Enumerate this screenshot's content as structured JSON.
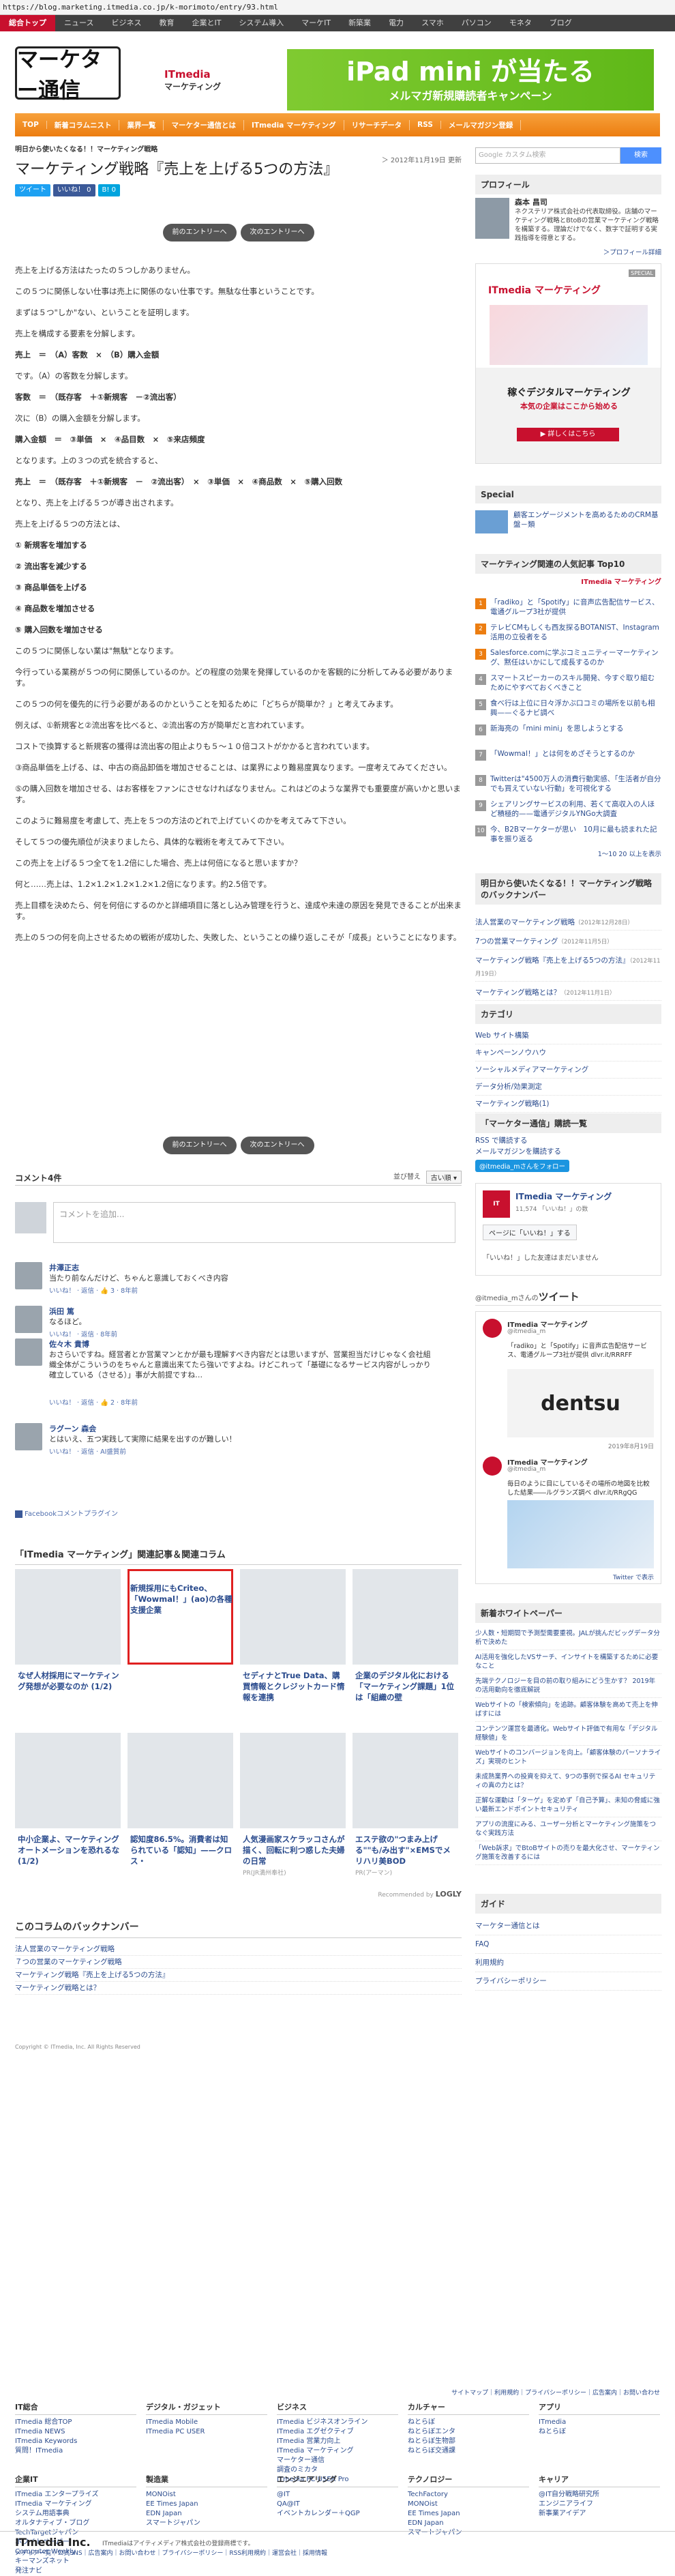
{
  "url": "https://blog.marketing.itmedia.co.jp/k-morimoto/entry/93.html",
  "gnav": [
    "総合トップ",
    "ニュース",
    "ビジネス",
    "教育",
    "企業とIT",
    "システム導入",
    "マーケIT",
    "新築業",
    "電力",
    "スマホ",
    "パソコン",
    "モネタ",
    "ブログ"
  ],
  "logo": "マーケター通信",
  "banner": {
    "brand": "ITmedia",
    "sub": "マーケティング",
    "headline": "iPad mini が当たる",
    "caption": "メルマガ新規購読者キャンペーン"
  },
  "onav": [
    "TOP",
    "新着コラムニスト",
    "業界一覧",
    "マーケター通信とは",
    "ITmedia マーケティング",
    "リサーチデータ",
    "RSS",
    "メールマガジン登録"
  ],
  "breadcrumb": "明日から使いたくなる！！マーケティング戦略",
  "date": "＞ 2012年11月19日 更新",
  "title": "マーケティング戦略『売上を上げる5つの方法』",
  "share": {
    "tweet": "ツイート",
    "like": "いいね！ 0",
    "hatena": "B! 0"
  },
  "pager": {
    "prev": "前のエントリーへ",
    "next": "次のエントリーへ"
  },
  "body": [
    "売上を上げる方法はたったの５つしかありません。",
    "この５つに関係しない仕事は売上に関係のない仕事です。無駄な仕事ということです。",
    "まずは５つ\"しか\"ない、ということを証明します。",
    "売上を構成する要素を分解します。",
    "売上　＝　（A）客数　×　（B）購入金額",
    "です。（A）の客数を分解します。",
    "客数　＝　（既存客　＋①新規客　－②流出客）",
    "次に（B）の購入金額を分解します。",
    "購入金額　＝　③単価　×　④品目数　×　⑤来店頻度",
    "となります。上の３つの式を統合すると、",
    "売上　＝　（既存客　＋①新規客　－　②流出客）　×　③単価　×　④商品数　×　⑤購入回数",
    "となり、売上を上げる５つが導き出されます。",
    "売上を上げる５つの方法とは、",
    "① 新規客を増加する",
    "② 流出客を減少する",
    "③ 商品単価を上げる",
    "④ 商品数を増加させる",
    "⑤ 購入回数を増加させる",
    "この５つに関係しない業は\"無駄\"となります。",
    "今行っている業務が５つの何に関係しているのか。どの程度の効果を発揮しているのかを客観的に分析してみる必要があります。",
    "この５つの何を優先的に行う必要があるのかということを知るために「どちらが簡単か？」と考えてみます。",
    "例えば、①新規客と②流出客を比べると、②流出客の方が簡単だと言われています。",
    "コストで換算すると新規客の獲得は流出客の阻止よりも５～１０倍コストがかかると言われています。",
    "③商品単価を上げる、は、中古の商品卸価を増加させることは、は業界により難易度異なります。一度考えてみてください。",
    "⑤の購入回数を増加させる、はお客様をファンにさせなければなりません。これはどのような業界でも重要度が高いかと思います。",
    "このように難易度を考慮して、売上を５つの方法のどれで上げていくのかを考えてみて下さい。",
    "そして５つの優先順位が決まりましたら、具体的な戦術を考えてみて下さい。",
    "この売上を上げる５つ全てを1.2倍にした場合、売上は何倍になると思いますか？",
    "何と……売上は、1.2×1.2×1.2×1.2×1.2倍になります。約2.5倍です。",
    "売上目標を決めたら、何を何倍にするのかと詳細項目に落とし込み管理を行うと、達成や未達の原因を発見できることが出来ます。",
    "売上の５つの何を向上させるための戦術が成功した、失敗した、ということの繰り返しこそが「成長」ということになります。"
  ],
  "comments": {
    "heading": "コメント4件",
    "sort_label": "並び替え",
    "sort_value": "古い順 ▾",
    "placeholder": "コメントを追加...",
    "items": [
      {
        "name": "井澤正志",
        "text": "当たり前なんだけど、ちゃんと意識しておくべき内容",
        "action": "いいね！ · 返信 · 👍 3 · 8年前"
      },
      {
        "name": "浜田 篤",
        "text": "なるほど。",
        "action": "いいね！ · 返信 · 8年前"
      },
      {
        "name": "佐々木 貴博",
        "text": "おさらいですね。経営者とか営業マンとかが最も理解すべき内容だとは思いますが、営業担当だけじゃなく会社組織全体がこういうのをちゃんと意識出来てたら強いですよね。けどこれって「基礎になるサービス内容がしっかり確立している（させる）」事が大前提ですね…",
        "action": "いいね！ · 返信 · 👍 2 · 8年前"
      },
      {
        "name": "ラグーン 森会",
        "text": "とはいえ、五つ実践して実際に結果を出すのが難しい！",
        "action": "いいね！ · 返信 · AI盛質前"
      }
    ],
    "plugin": "Facebookコメントプラグイン"
  },
  "related": {
    "heading": "「ITmedia マーケティング」関連記事＆関連コラム",
    "row1": [
      {
        "title": "なぜ人材採用にマーケティング発想が必要なのか (1/2)"
      },
      {
        "title": "新規採用にもCriteo、「Wowmal！」(ao)の各種支援企業"
      },
      {
        "title": "セディナとTrue Data、購買情報とクレジットカード情報を連携"
      },
      {
        "title": "企業のデジタル化における「マーケティング課題」1位は「組織の壁"
      }
    ],
    "row2": [
      {
        "title": "中小企業よ、マーケティングオートメーションを恐れるな (1/2)"
      },
      {
        "title": "認知度86.5%。消費者は知られている「認知」——クロス・"
      },
      {
        "title": "人気漫画家スケラッコさんが描く、回転に利つ惑した夫婦の日常",
        "sub": "PR(JR満州奉社)"
      },
      {
        "title": "エステ欲の\"つまみ上げる\"\"も/み出す\"×EMSでメリハリ美BOD",
        "sub": "PR(アーマン)"
      }
    ],
    "recommended": "Recommended by",
    "logly": "LOGLY"
  },
  "backnumber": {
    "heading": "このコラムのバックナンバー",
    "items": [
      "法人営業のマーケティング戦略",
      "７つの営業のマーケティング戦略",
      "マーケティング戦略『売上を上げる5つの方法』",
      "マーケティング戦略とは？"
    ]
  },
  "copyright": "Copyright © ITmedia, Inc. All Rights Reserved",
  "sidebar": {
    "search_placeholder": "Google カスタム検索",
    "search_button": "検索",
    "profile_heading": "プロフィール",
    "profile_name": "森本 昌司",
    "profile_text": "ネクステリア株式会社の代表取締役。店舗のマーケティング戦略とBtoBの営業マーケティング戦略を構築する。理論だけでなく、数字で証明する実践指導を得意とする。",
    "profile_link": "＞プロフィール詳細",
    "ad_brand": "ITmedia マーケティング",
    "ad_tag": "SPECIAL",
    "ad_line1": "稼ぐデジタルマーケティング",
    "ad_line2": "本気の企業はここから始める",
    "ad_more": "▶ 詳しくはこちら",
    "special_heading": "Special",
    "special_text": "顧客エンゲージメントを高めるためのCRM基盤－類",
    "ranking_heading": "マーケティング関連の人気記事 Top10",
    "ranking": [
      "「radiko」と「Spotify」に音声広告配信サービス、電通グループ3社が提供",
      "テレビCMもしくも西友探るBOTANIST、Instagram活用の立役者をる",
      "Salesforce.comに学ぶコミュニティーマーケティング、黙任はいかにして成長するのか",
      "スマートスピーカーのスキル開発、今すぐ取り組むためにやすべておくべきこと",
      "食べ行は上位に日々浮かぶ口コミの場所を以前も相興——ぐるナビ調べ",
      "新海亮の「mini mini」を思しようとする",
      "「Wowmal！」とは何をめざそうとするのか",
      "Twitterは\"4500万人の消費行動実感、「生活者が自分でも買えていない行動」を可視化する",
      "シェアリングサービスの利用、若くて高収入の人ほど積極的——電通デジタルYNGo大調査",
      "今、B2Bマーケターが思い　10月に最も読まれた記事を振り返る"
    ],
    "ranking_more": "1〜10 20 以上を表示",
    "series_heading": "明日から使いたくなる！！マーケティング戦略のバックナンバー",
    "series": [
      {
        "title": "法人営業のマーケティング戦略",
        "date": "（2012年12月28日）"
      },
      {
        "title": "7つの営業マーケティング",
        "date": "（2012年11月5日）"
      },
      {
        "title": "マーケティング戦略『売上を上げる5つの方法』",
        "date": "（2012年11月19日）"
      },
      {
        "title": "マーケティング戦略とは？",
        "date": "（2012年11月1日）"
      }
    ],
    "category_heading": "カテゴリ",
    "categories": [
      "Web サイト構築",
      "キャンペーンノウハウ",
      "ソーシャルメディアマーケティング",
      "データ分析/効果測定",
      "マーケティング戦略(1)"
    ],
    "subscribe_heading": "「マーケター通信」購読一覧",
    "subscribe": [
      "RSS で購読する",
      "メールマガジンを購読する"
    ],
    "twitter_follow": "@itmedia_mさんをフォロー",
    "fb_name": "ITmedia マーケティング",
    "fb_likes": "11,574 「いいね！」の数",
    "fb_button": "ページに「いいね！」する",
    "fb_friends": "「いいね！」した友達はまだいません",
    "tw_heading_user": "@itmedia_mさんの",
    "tw_heading": "ツイート",
    "tweet1_user": "ITmedia マーケティング",
    "tweet1_handle": "@itmedia_m",
    "tweet1_text": "「radiko」と「Spotify」に音声広告配信サービス、電通グループ3社が提供 dlvr.it/RRRFF",
    "tweet_img": "dentsu",
    "tweet_date": "2019年8月19日",
    "tweet2_user": "ITmedia マーケティング",
    "tweet2_handle": "@itmedia_m",
    "tweet2_text": "毎日のように目にしているその場所の地図を比較した結果――ルグランズ調べ dlvr.it/RRgQG",
    "tw_embed": "Twitter で表示",
    "whitepaper_heading": "新着ホワイトペーパー",
    "whitepapers": [
      "少人数・短期間で予測型需要重視。JALが挑んだビッグデータ分析で決めた",
      "AI活用を強化したVSサーチ、インサイトを構築するために必要なこと",
      "先端テクノロジーを目の前の取り組みにどう生かす？ 2019年の活用動向を徹底解説",
      "Webサイトの「検索傾向」を追跡。顧客体験を高めて売上を伸ばすには",
      "コンテンツ運営を最適化。Webサイト評価で有用な「デジタル経験値」を",
      "Webサイトのコンバージョンを向上。「顧客体験のパーソナライズ」実現のヒント",
      "未成熟業界への投資を抑えて、9つの事例で探るAI セキュリティの真の力とは？",
      "正解な運動は「ターゲ」を定めず「自己予算」、未知の脅威に強い最新エンドポイントセキュリティ",
      "アプリの流度にみる、ユーザー分析とマーケティング施策をつなぐ実践方法",
      "「Web訴求」でBtoBサイトの売りを最大化させ、マーケティング施策を改善するには"
    ],
    "guide_heading": "ガイド",
    "guide": [
      "マーケター通信とは",
      "FAQ",
      "利用規約",
      "プライバシーポリシー"
    ]
  },
  "footer": {
    "sitemap": "サイトマップ｜利用規約｜プライバシーポリシー｜広告案内｜お問い合わせ",
    "cols1": [
      {
        "title": "IT総合",
        "items": [
          "ITmedia 総合TOP",
          "ITmedia NEWS",
          "ITmedia Keywords",
          "質問！ITmedia"
        ]
      },
      {
        "title": "デジタル・ガジェット",
        "items": [
          "ITmedia Mobile",
          "ITmedia PC USER"
        ]
      },
      {
        "title": "ビジネス",
        "items": [
          "ITmedia ビジネスオンライン",
          "ITmedia エグゼクティブ",
          "ITmedia 営業力向上",
          "ITmedia マーケティング",
          "マーケター通信",
          "調査のミカタ",
          "ITmedia PC USER Pro"
        ]
      },
      {
        "title": "カルチャー",
        "items": [
          "ねとらぼ",
          "ねとらぼエンタ",
          "ねとらぼ生物部",
          "ねとらぼ交通課"
        ]
      },
      {
        "title": "アプリ",
        "items": [
          "ITmedia",
          "ねとらぼ"
        ]
      }
    ],
    "cols2": [
      {
        "title": "企業IT",
        "items": [
          "ITmedia エンタープライズ",
          "ITmedia マーケティング",
          "システム用語事典",
          "オルタナティブ・ブログ",
          "TechTargetジャパン",
          "ホワイトペーパー",
          "Computer Weekly",
          "キーマンズネット",
          "発注ナビ"
        ]
      },
      {
        "title": "製造業",
        "items": [
          "MONOist",
          "EE Times Japan",
          "EDN Japan",
          "スマートジャパン"
        ]
      },
      {
        "title": "エンジニアリング",
        "items": [
          "@IT",
          "QA@IT",
          "イベントカレンダー＋QGP"
        ]
      },
      {
        "title": "テクノロジー",
        "items": [
          "TechFactory",
          "MONOist",
          "EE Times Japan",
          "EDN Japan",
          "スマートジャパン"
        ]
      },
      {
        "title": "キャリア",
        "items": [
          "@IT自分戦略研究所",
          "エンジニアライフ",
          "新事業アイデア"
        ]
      }
    ],
    "company": "ITmedia Inc.",
    "company_note": "ITmediaはアイティメディア株式会社の登録商標です。",
    "links": "メディア一覧｜公式SNS｜広告案内｜お問い合わせ｜プライバシーポリシー｜RSS利用規約｜運営会社｜採用情報"
  },
  "colors": {
    "accent": "#c8102e",
    "orange": "#ec7d10",
    "link": "#2a4b8d",
    "banner_green": "#6dbf1f"
  }
}
